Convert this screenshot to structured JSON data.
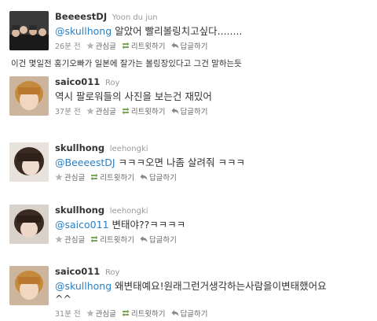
{
  "colors": {
    "mention": "#2b7fc3",
    "meta": "#8a8a8a",
    "realname": "#999999"
  },
  "actions": {
    "favorite": "관심글",
    "retweet": "리트윗하기",
    "reply": "답글하기"
  },
  "tweets": [
    {
      "screen_name": "BeeeestDJ",
      "real_name": "Yoon du jun",
      "mention": "@skullhong",
      "text": " 알았어 빨리볼링치고싶다........",
      "time": "26분 전"
    },
    {
      "screen_name": "saico011",
      "real_name": "Roy",
      "mention": "",
      "text": "역시 팔로워들의 사진을 보는건 재밌어",
      "time": "37분 전"
    },
    {
      "screen_name": "skullhong",
      "real_name": "leehongki",
      "mention": "@BeeeestDJ",
      "text": " ㅋㅋㅋ오면 나좀 살려줘 ㅋㅋㅋ",
      "time": ""
    },
    {
      "screen_name": "skullhong",
      "real_name": "leehongki",
      "mention": "@saico011",
      "text": " 변태야??ㅋㅋㅋㅋ",
      "time": ""
    },
    {
      "screen_name": "saico011",
      "real_name": "Roy",
      "mention": "@skullhong",
      "text": " 왜변태예요!원래그런거생각하는사람을이변태했어요",
      "text2": "^^",
      "time": "31분 전"
    }
  ],
  "note": "이건 몇일전 홍기오빠가 일본에 잘가는 볼링장있다고 그건 말하는듯"
}
